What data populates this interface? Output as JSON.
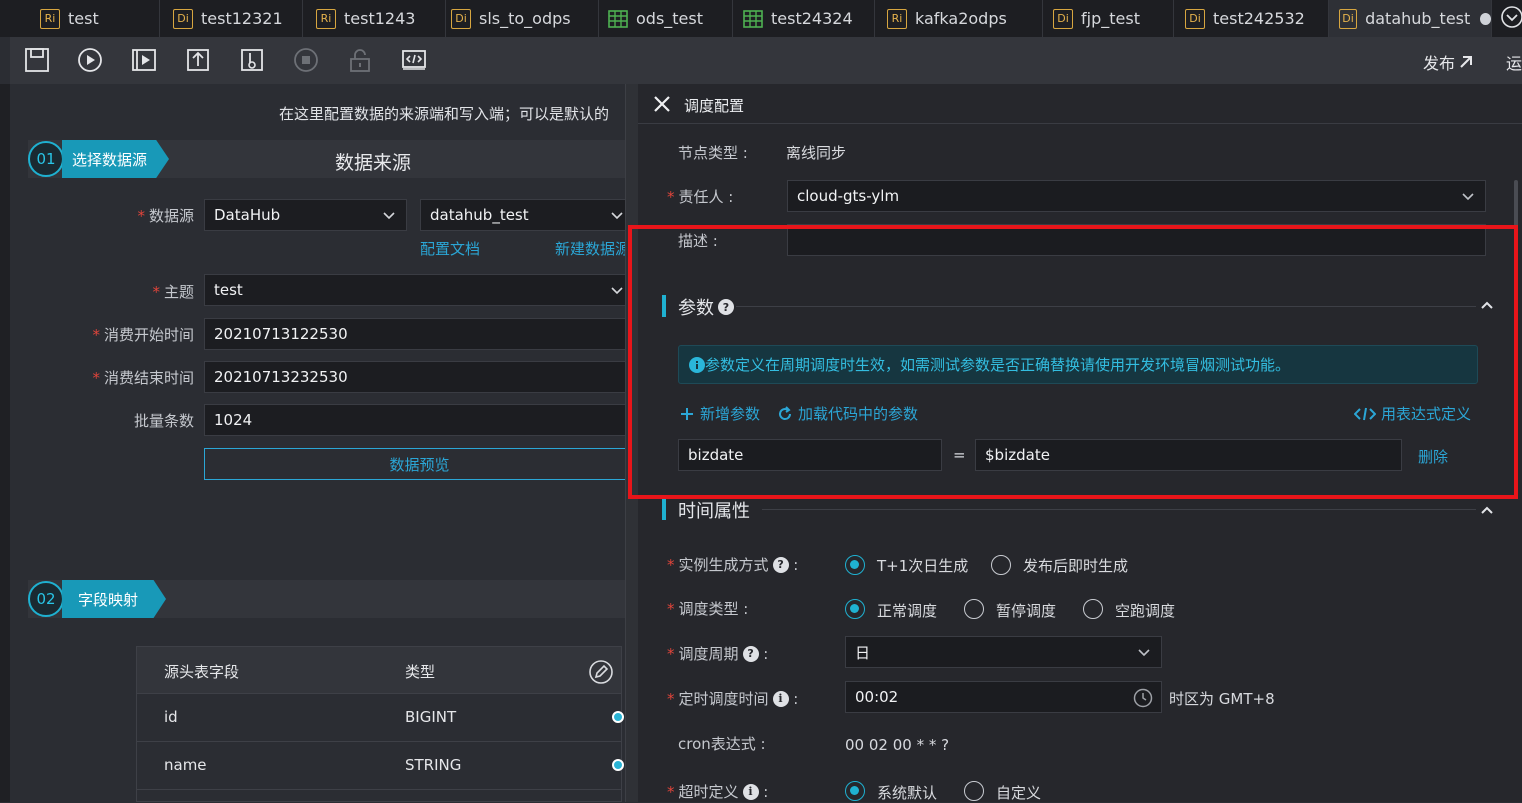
{
  "tabs": [
    {
      "badge": "Ri",
      "label": "test"
    },
    {
      "badge": "Di",
      "label": "test12321"
    },
    {
      "badge": "Ri",
      "label": "test1243"
    },
    {
      "badge": "Di",
      "label": "sls_to_odps"
    },
    {
      "badge": "grid",
      "label": "ods_test"
    },
    {
      "badge": "grid",
      "label": "test24324"
    },
    {
      "badge": "Ri",
      "label": "kafka2odps"
    },
    {
      "badge": "Di",
      "label": "fjp_test"
    },
    {
      "badge": "Di",
      "label": "test242532"
    },
    {
      "badge": "Di",
      "label": "datahub_test"
    }
  ],
  "toolbar": {
    "icons": [
      "save-icon",
      "run-icon",
      "run-params-icon",
      "submit-icon",
      "deploy-icon",
      "stop-icon",
      "lock-icon",
      "code-icon"
    ],
    "publish_label": "发布",
    "ops_label": "运"
  },
  "left": {
    "intro": "在这里配置数据的来源端和写入端；可以是默认的",
    "step1": {
      "num": "01",
      "label": "选择数据源",
      "title": "数据来源"
    },
    "form": {
      "datasource_label": "数据源",
      "datasource_type": "DataHub",
      "datasource_name": "datahub_test",
      "config_doc_link": "配置文档",
      "new_datasource_link": "新建数据源",
      "topic_label": "主题",
      "topic_value": "test",
      "start_label": "消费开始时间",
      "start_value": "20210713122530",
      "end_label": "消费结束时间",
      "end_value": "20210713232530",
      "batch_label": "批量条数",
      "batch_value": "1024",
      "preview_button": "数据预览"
    },
    "step2": {
      "num": "02",
      "label": "字段映射"
    },
    "table": {
      "headers": [
        "源头表字段",
        "类型"
      ],
      "rows": [
        {
          "field": "id",
          "type": "BIGINT"
        },
        {
          "field": "name",
          "type": "STRING"
        }
      ]
    }
  },
  "right": {
    "title": "调度配置",
    "node_type_label": "节点类型",
    "node_type_value": "离线同步",
    "owner_label": "责任人",
    "owner_value": "cloud-gts-ylm",
    "desc_label": "描述",
    "desc_value": "",
    "params": {
      "title": "参数",
      "notice": "参数定义在周期调度时生效，如需测试参数是否正确替换请使用开发环境冒烟测试功能。",
      "add_label": "新增参数",
      "load_label": "加载代码中的参数",
      "expr_label": "用表达式定义",
      "param_name": "bizdate",
      "equals": "=",
      "param_value": "$bizdate",
      "delete_label": "删除"
    },
    "time": {
      "title": "时间属性",
      "instance_label": "实例生成方式",
      "instance_opt1": "T+1次日生成",
      "instance_opt2": "发布后即时生成",
      "sched_type_label": "调度类型",
      "sched_opt1": "正常调度",
      "sched_opt2": "暂停调度",
      "sched_opt3": "空跑调度",
      "period_label": "调度周期",
      "period_value": "日",
      "time_label": "定时调度时间",
      "time_value": "00:02",
      "timezone": "时区为 GMT+8",
      "cron_label": "cron表达式",
      "cron_value": "00 02 00 * * ?",
      "timeout_label": "超时定义",
      "timeout_opt1": "系统默认",
      "timeout_opt2": "自定义"
    }
  },
  "colors": {
    "accent": "#1fb1d1",
    "highlight_box": "#e8151a",
    "required": "#e0453b"
  }
}
